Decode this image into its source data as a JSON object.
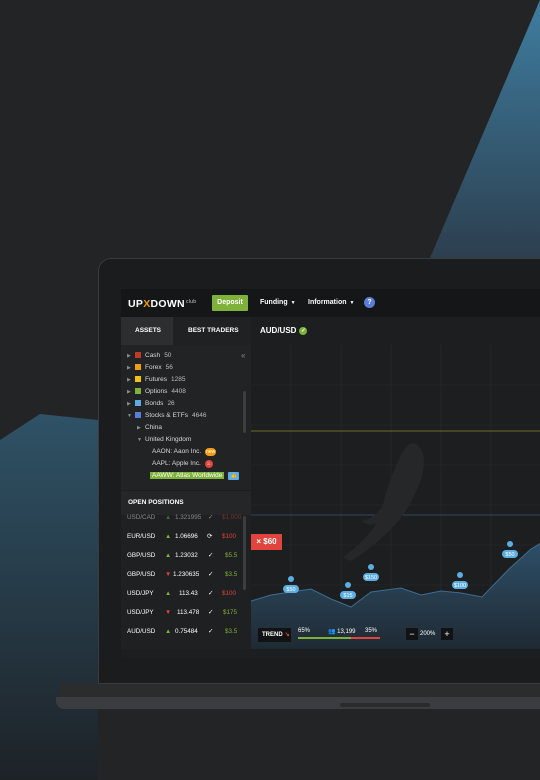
{
  "app": {
    "logo": {
      "pre": "UP",
      "mid": "X",
      "post": "DOWN",
      "club": "club"
    },
    "deposit_label": "Deposit",
    "menu": [
      {
        "label": "Funding"
      },
      {
        "label": "Information"
      }
    ],
    "help": "?"
  },
  "tabs": [
    {
      "label": "ASSETS",
      "active": true
    },
    {
      "label": "BEST TRADERS",
      "active": false
    }
  ],
  "pair": "AUD/USD",
  "asset_tree": [
    {
      "label": "Cash",
      "count": "50",
      "color": "#c0392b"
    },
    {
      "label": "Forex",
      "count": "56",
      "color": "#f39c12"
    },
    {
      "label": "Futures",
      "count": "1285",
      "color": "#f1c40f"
    },
    {
      "label": "Options",
      "count": "4408",
      "color": "#7fb23a"
    },
    {
      "label": "Bonds",
      "count": "26",
      "color": "#5dade2"
    },
    {
      "label": "Stocks & ETFs",
      "count": "4646",
      "color": "#5a7ed8"
    }
  ],
  "regions": [
    {
      "label": "China"
    },
    {
      "label": "United Kingdom"
    }
  ],
  "uk_assets": [
    {
      "label": "AAON: Aaon Inc.",
      "icon": "new-badge-icon"
    },
    {
      "label": "AAPL: Apple Inc.",
      "icon": "fire-icon"
    },
    {
      "label": "AAWW: Atlas Worldwide",
      "icon": "thumbs-up-icon"
    }
  ],
  "open_positions_title": "OPEN POSITIONS",
  "positions": [
    {
      "pair": "USD/CAD",
      "dir": "up",
      "price": "1.321995",
      "amount": "$1,000"
    },
    {
      "pair": "EUR/USD",
      "dir": "up",
      "price": "1.06696",
      "amount": "$100"
    },
    {
      "pair": "GBP/USD",
      "dir": "up",
      "price": "1.23032",
      "amount": "$5.5"
    },
    {
      "pair": "GBP/USD",
      "dir": "down",
      "price": "1.230635",
      "amount": "$3.5"
    },
    {
      "pair": "USD/JPY",
      "dir": "up",
      "price": "113.43",
      "amount": "$100"
    },
    {
      "pair": "USD/JPY",
      "dir": "down",
      "price": "113.478",
      "amount": "$175"
    },
    {
      "pair": "AUD/USD",
      "dir": "up",
      "price": "0.75484",
      "amount": "$3.5"
    }
  ],
  "callout": "× $60",
  "chart_data": {
    "type": "area",
    "markers": [
      {
        "label": "$50",
        "dir": "up"
      },
      {
        "label": "$15",
        "dir": "up"
      },
      {
        "label": "$150",
        "dir": "up"
      },
      {
        "label": "$100",
        "dir": "up"
      },
      {
        "label": "$50",
        "dir": "up"
      }
    ]
  },
  "trend": {
    "label": "TREND",
    "left_pct": "65%",
    "traders": "13,199",
    "right_pct": "35%"
  },
  "zoom": {
    "value": "200%",
    "minus": "−",
    "plus": "+"
  },
  "colors": {
    "accent_green": "#7fb23a",
    "accent_red": "#e0443c",
    "accent_blue": "#3a6fa8",
    "brand_orange": "#f39c12"
  }
}
